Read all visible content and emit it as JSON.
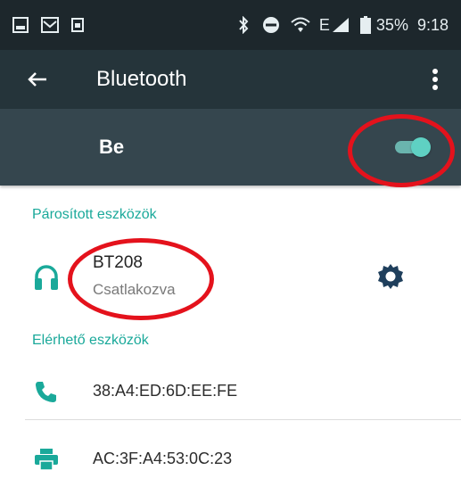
{
  "status_bar": {
    "battery": "35%",
    "time": "9:18",
    "network": "E",
    "left_icons": [
      "gallery-icon",
      "mail-icon",
      "sim-icon"
    ],
    "right_icons": [
      "bluetooth-icon",
      "do-not-disturb-icon",
      "wifi-icon",
      "signal-icon",
      "battery-icon"
    ]
  },
  "app_bar": {
    "title": "Bluetooth",
    "back_icon": "arrow-left-icon",
    "menu_icon": "more-vert-icon"
  },
  "switch": {
    "label": "Be",
    "state": "on",
    "accent": "#5fd1c3"
  },
  "paired": {
    "header": "Párosított eszközök",
    "devices": [
      {
        "name": "BT208",
        "status": "Csatlakozva",
        "icon": "headset-icon",
        "settings_icon": "gear-icon"
      }
    ]
  },
  "available": {
    "header": "Elérhető eszközök",
    "devices": [
      {
        "address": "38:A4:ED:6D:EE:FE",
        "icon": "phone-icon"
      },
      {
        "address": "AC:3F:A4:53:0C:23",
        "icon": "printer-icon"
      }
    ]
  },
  "colors": {
    "status_bar_bg": "#1d272c",
    "app_bar_bg": "#25343a",
    "switch_bar_bg": "#35464e",
    "teal_accent": "#1aa99a",
    "annotation_red": "#e4121c"
  }
}
